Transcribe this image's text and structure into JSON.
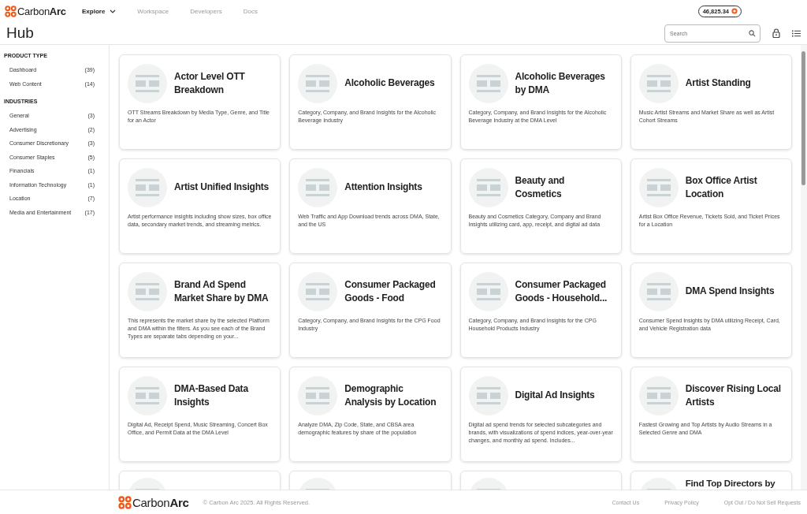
{
  "nav": {
    "logo": "Carbon**Arc**",
    "items": [
      {
        "label": "Explore",
        "selected": true,
        "dropdown": true
      },
      {
        "label": "Workspace",
        "selected": false,
        "dropdown": false
      },
      {
        "label": "Developers",
        "selected": false,
        "dropdown": false
      },
      {
        "label": "Docs",
        "selected": false,
        "dropdown": false
      }
    ],
    "credits": "46,825.34"
  },
  "header": {
    "title": "Hub",
    "search": {
      "placeholder": "Search"
    }
  },
  "sidebar": {
    "sections": [
      {
        "heading": "PRODUCT TYPE",
        "items": [
          {
            "label": "Dashboard",
            "count": "(39)"
          },
          {
            "label": "Web Content",
            "count": "(14)"
          }
        ]
      },
      {
        "heading": "INDUSTRIES",
        "items": [
          {
            "label": "General",
            "count": "(3)"
          },
          {
            "label": "Advertising",
            "count": "(2)"
          },
          {
            "label": "Consumer Discretionary",
            "count": "(3)"
          },
          {
            "label": "Consumer Staples",
            "count": "(5)"
          },
          {
            "label": "Financials",
            "count": "(1)"
          },
          {
            "label": "Information Technology",
            "count": "(1)"
          },
          {
            "label": "Location",
            "count": "(7)"
          },
          {
            "label": "Media and Entertainment",
            "count": "(17)"
          }
        ]
      }
    ]
  },
  "cards": [
    {
      "title": "Actor Level OTT Breakdown",
      "description": "OTT Streams Breakdown by Media Type, Genre, and Title for an Actor"
    },
    {
      "title": "Alcoholic Beverages",
      "description": "Category, Company, and Brand Insights for the Alcoholic Beverage Industry"
    },
    {
      "title": "Alcoholic Beverages by DMA",
      "description": "Category, Company, and Brand Insights for the Alcoholic Beverage Industry at the DMA Level"
    },
    {
      "title": "Artist Standing",
      "description": "Music Artist Streams and Market Share as well as Artist Cohort Streams"
    },
    {
      "title": "Artist Unified Insights",
      "description": "Artist performance insights including show sizes, box office data, secondary market trends, and streaming metrics."
    },
    {
      "title": "Attention Insights",
      "description": "Web Traffic and App Download trends across DMA, State, and the US"
    },
    {
      "title": "Beauty and Cosmetics",
      "description": "Beauty and Cosmetics Category, Company and Brand Insights utilizing card, app, receipt, and digital ad data"
    },
    {
      "title": "Box Office Artist Location",
      "description": "Artist Box Office Revenue, Tickets Sold, and Ticket Prices for a Location"
    },
    {
      "title": "Brand Ad Spend Market Share by DMA",
      "description": "This represents the market share by the selected Platform and DMA within the filters. As you see each of the Brand Types are separate tabs depending on your..."
    },
    {
      "title": "Consumer Packaged Goods - Food",
      "description": "Category, Company, and Brand Insights for the CPG Food Industry"
    },
    {
      "title": "Consumer Packaged Goods - Household...",
      "description": "Category, Company, and Brand Insights for the CPG Household Products Industry"
    },
    {
      "title": "DMA Spend Insights",
      "description": "Consumer Spend Insights by DMA utilizing Receipt, Card, and Vehicle Registration data"
    },
    {
      "title": "DMA-Based Data Insights",
      "description": "Digital Ad, Receipt Spend, Music Streaming, Concert Box Office, and Permit Data at the DMA Level"
    },
    {
      "title": "Demographic Analysis by Location",
      "description": "Analyze DMA, Zip Code, State, and CBSA area demographic features by share of the population"
    },
    {
      "title": "Digital Ad Insights",
      "description": "Digital ad spend trends for selected subcategories and brands, with visualizations of spend indices, year-over-year changes, and monthly ad spend. Includes..."
    },
    {
      "title": "Discover Rising Local Artists",
      "description": "Fastest Growing and Top Artists by Audio Streams in a Selected Genre and DMA"
    },
    {
      "kind": "partial"
    },
    {
      "kind": "partial"
    },
    {
      "kind": "partial"
    },
    {
      "kind": "partial",
      "title": "Find Top Directors by"
    }
  ],
  "footer": {
    "logo": "Carbon**Arc**",
    "copyright": "© Carbon Arc 2025. All Rights Reserved.",
    "links": [
      "Contact Us",
      "Privacy Policy",
      "Opt Out / Do Not Sell Requests"
    ]
  }
}
